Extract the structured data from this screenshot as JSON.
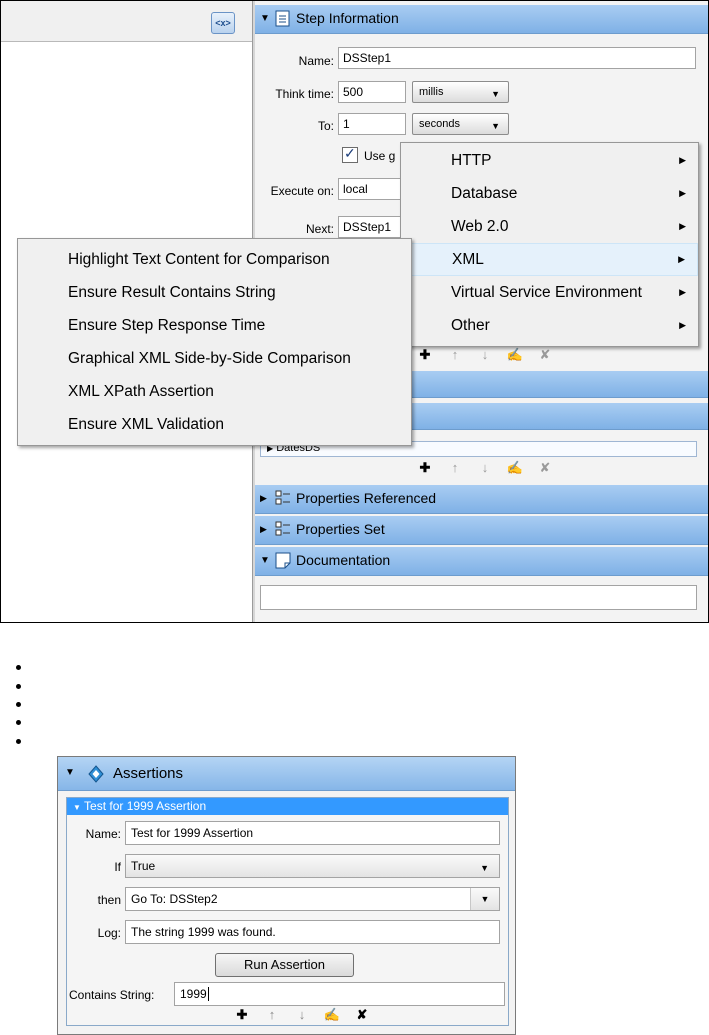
{
  "top": {
    "xml_icon_text": "<x>",
    "step_info": {
      "header": "Step Information",
      "name_label": "Name:",
      "name_value": "DSStep1",
      "think_label": "Think time:",
      "think_value": "500",
      "think_unit": "millis",
      "to_label": "To:",
      "to_value": "1",
      "to_unit": "seconds",
      "use_label": "Use g",
      "execute_label": "Execute on:",
      "execute_value": "local",
      "next_label": "Next:",
      "next_value": "DSStep1"
    },
    "data_sets_item": "DatesDS",
    "sections": {
      "props_referenced": "Properties Referenced",
      "props_set": "Properties Set",
      "documentation": "Documentation"
    },
    "tool_glyphs": {
      "add": "✚",
      "up": "↑",
      "down": "↓",
      "edit": "✍",
      "delete": "✘"
    },
    "category_menu": [
      {
        "label": "HTTP"
      },
      {
        "label": "Database"
      },
      {
        "label": "Web 2.0"
      },
      {
        "label": "XML"
      },
      {
        "label": "Virtual Service Environment"
      },
      {
        "label": "Other"
      }
    ],
    "xml_menu": [
      {
        "label": "Highlight Text Content for Comparison"
      },
      {
        "label": "Ensure Result Contains String"
      },
      {
        "label": "Ensure Step Response Time"
      },
      {
        "label": "Graphical XML Side-by-Side Comparison"
      },
      {
        "label": "XML XPath Assertion"
      },
      {
        "label": "Ensure XML Validation"
      }
    ]
  },
  "bottom": {
    "header": "Assertions",
    "assertion_title": "Test for 1999 Assertion",
    "name_label": "Name:",
    "name_value": "Test for 1999 Assertion",
    "if_label": "If",
    "if_value": "True",
    "then_label": "then",
    "then_value": "Go To:  DSStep2",
    "log_label": "Log:",
    "log_value": "The string 1999 was found.",
    "run_button": "Run Assertion",
    "contains_label": "Contains String:",
    "contains_value": "1999"
  },
  "colors": {
    "header_blue": "#8ab9ea",
    "selection_blue": "#3399ff"
  }
}
